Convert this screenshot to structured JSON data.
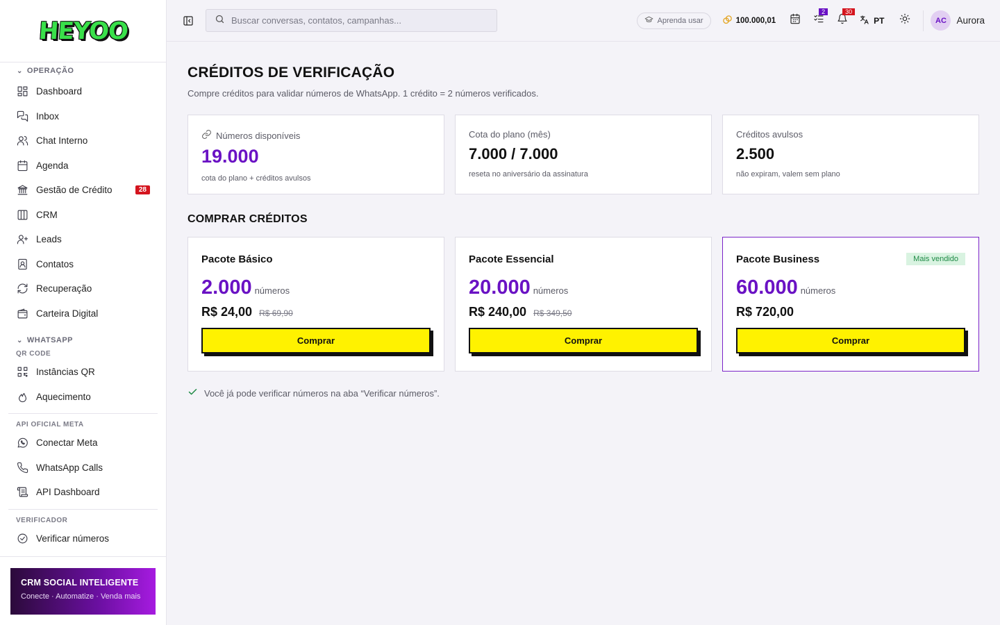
{
  "brand": {
    "logo_text": "HEYOO"
  },
  "sidebar": {
    "sections": {
      "operacao": "OPERAÇÃO",
      "whatsapp": "WHATSAPP",
      "qr_code": "QR CODE",
      "api_meta": "API OFICIAL META",
      "verificador": "VERIFICADOR"
    },
    "items": {
      "dashboard": "Dashboard",
      "inbox": "Inbox",
      "chat_interno": "Chat Interno",
      "agenda": "Agenda",
      "gestao_credito": "Gestão de Crédito",
      "gestao_credito_badge": "28",
      "crm": "CRM",
      "leads": "Leads",
      "contatos": "Contatos",
      "recuperacao": "Recuperação",
      "carteira": "Carteira Digital",
      "instancias_qr": "Instâncias QR",
      "aquecimento": "Aquecimento",
      "conectar_meta": "Conectar Meta",
      "whatsapp_calls": "WhatsApp Calls",
      "api_dashboard": "API Dashboard",
      "verificar_numeros": "Verificar números"
    },
    "promo": {
      "title": "CRM SOCIAL INTELIGENTE",
      "subtitle": "Conecte · Automatize · Venda mais"
    }
  },
  "topbar": {
    "search_placeholder": "Buscar conversas, contatos, campanhas...",
    "learn_label": "Aprenda usar",
    "coins": "100.000,01",
    "tasks_badge": "2",
    "notifications_badge": "30",
    "language": "PT",
    "avatar_initials": "AC",
    "username": "Aurora",
    "colors": {
      "tasks_badge": "#6a12c4",
      "notifications_badge": "#d4141e"
    }
  },
  "page": {
    "title": "CRÉDITOS DE VERIFICAÇÃO",
    "subtitle": "Compre créditos para validar números de WhatsApp. 1 crédito = 2 números verificados.",
    "stats": [
      {
        "label": "Números disponíveis",
        "value": "19.000",
        "note": "cota do plano + créditos avulsos"
      },
      {
        "label": "Cota do plano (mês)",
        "value": "7.000 / 7.000",
        "note": "reseta no aniversário da assinatura"
      },
      {
        "label": "Créditos avulsos",
        "value": "2.500",
        "note": "não expiram, valem sem plano"
      }
    ],
    "buy_section_title": "COMPRAR CRÉDITOS",
    "packs": [
      {
        "name": "Pacote Básico",
        "amount": "2.000",
        "unit": "números",
        "price": "R$ 24,00",
        "old_price": "R$ 69,90",
        "button": "Comprar"
      },
      {
        "name": "Pacote Essencial",
        "amount": "20.000",
        "unit": "números",
        "price": "R$ 240,00",
        "old_price": "R$ 349,50",
        "button": "Comprar"
      },
      {
        "name": "Pacote Business",
        "tag": "Mais vendido",
        "amount": "60.000",
        "unit": "números",
        "price": "R$ 720,00",
        "button": "Comprar"
      }
    ],
    "notice": "Você já pode verificar números na aba “Verificar números”."
  },
  "colors": {
    "accent": "#6a12c4",
    "button": "#fff200",
    "success": "#1e8a45"
  }
}
